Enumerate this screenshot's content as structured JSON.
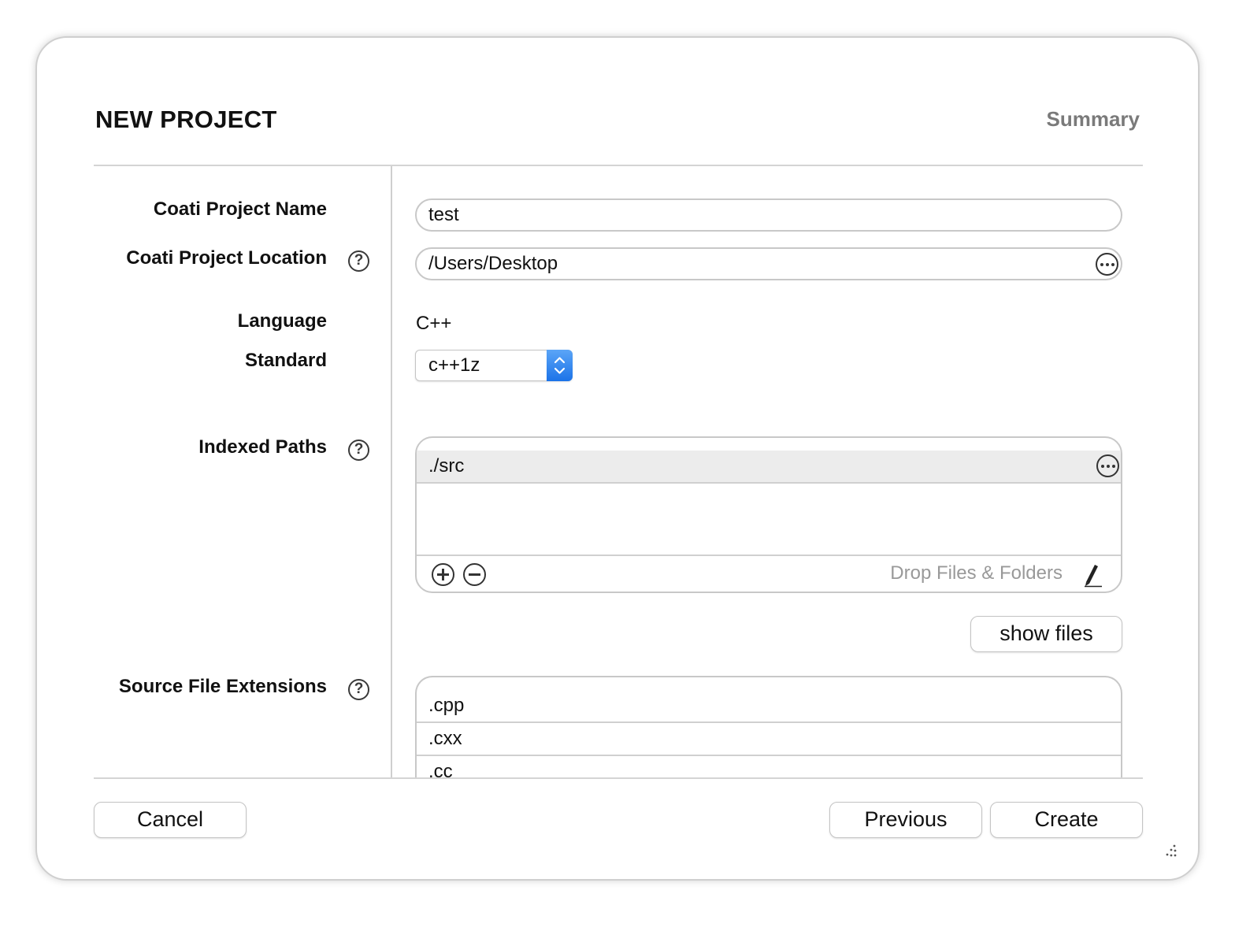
{
  "dialog": {
    "title": "NEW PROJECT",
    "step_label": "Summary"
  },
  "form": {
    "project_name": {
      "label": "Coati Project Name",
      "value": "test"
    },
    "project_location": {
      "label": "Coati Project Location",
      "value": "/Users/Desktop"
    },
    "language": {
      "label": "Language",
      "value": "C++"
    },
    "standard": {
      "label": "Standard",
      "value": "c++1z"
    },
    "indexed_paths": {
      "label": "Indexed Paths",
      "items": [
        "./src"
      ],
      "drop_hint": "Drop Files & Folders",
      "show_files_label": "show files"
    },
    "source_file_extensions": {
      "label": "Source File Extensions",
      "items": [
        ".cpp",
        ".cxx",
        ".cc"
      ]
    }
  },
  "help_icon_glyph": "?",
  "footer": {
    "cancel_label": "Cancel",
    "previous_label": "Previous",
    "create_label": "Create"
  },
  "colors": {
    "accent": "#1c73e8",
    "muted_text": "#7a7a7a"
  }
}
